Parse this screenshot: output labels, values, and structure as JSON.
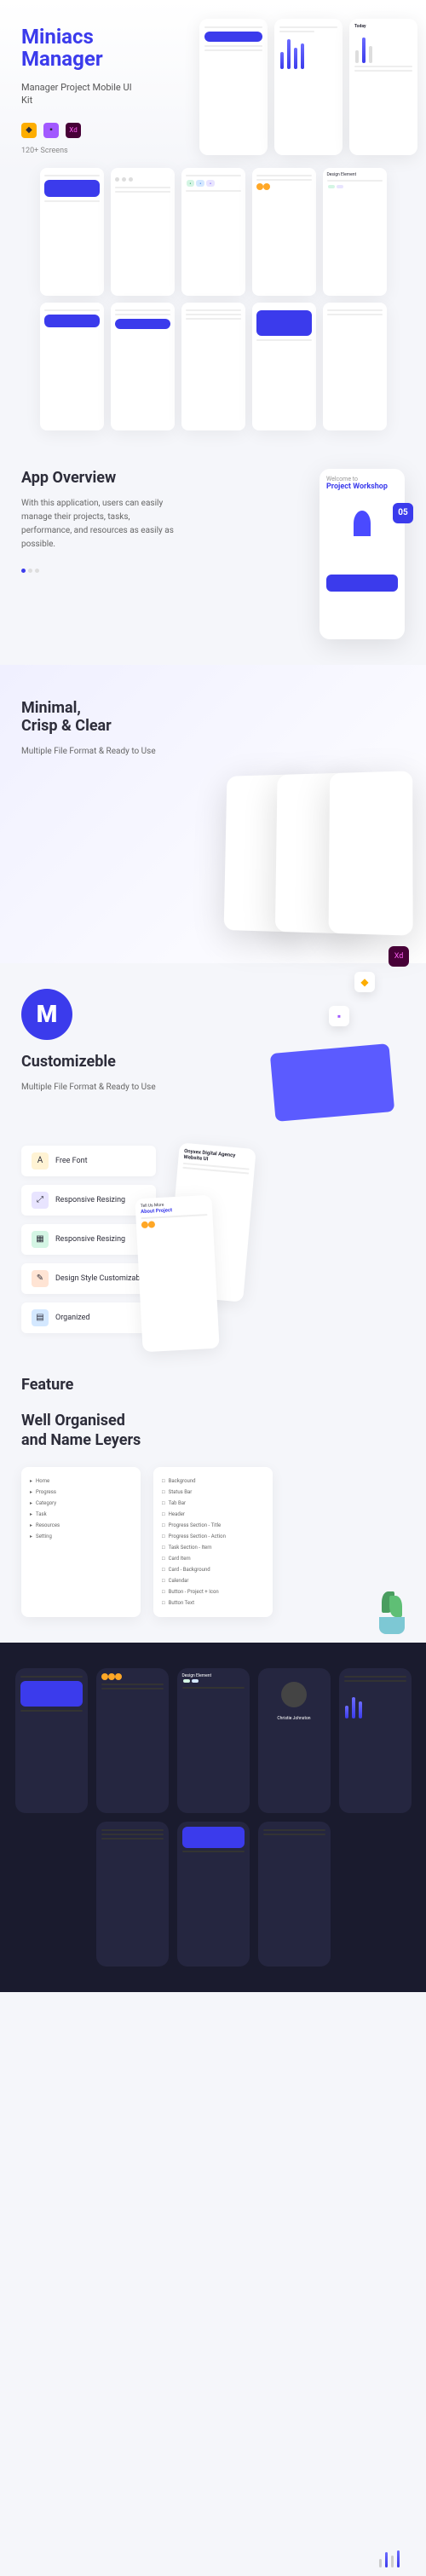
{
  "hero": {
    "title_line1": "Miniacs",
    "title_line2": "Manager",
    "subtitle": "Manager Project Mobile UI Kit",
    "screens_count": "120+ Screens"
  },
  "overview": {
    "title": "App Overview",
    "description": "With this application, users can easily manage their projects, tasks, performance, and resources as easily as possible.",
    "welcome": "Welcome to",
    "workshop": "Project Workshop",
    "date_badge": "05"
  },
  "minimal": {
    "title_line1": "Minimal,",
    "title_line2": "Crisp & Clear",
    "description": "Multiple File Format & Ready to Use"
  },
  "customizable": {
    "title": "Customizeble",
    "description": "Multiple File Format & Ready to Use"
  },
  "features": {
    "items": [
      {
        "label": "Free Font",
        "icon_class": "fi-yellow"
      },
      {
        "label": "Responsive Resizing",
        "icon_class": "fi-purple"
      },
      {
        "label": "Responsive Resizing",
        "icon_class": "fi-green"
      },
      {
        "label": "Design Style Customizable",
        "icon_class": "fi-orange"
      },
      {
        "label": "Organized",
        "icon_class": "fi-blue"
      }
    ],
    "section_title": "Feature",
    "about_title": "Tell Us More",
    "about_subtitle": "About Project",
    "page_title": "Onyxex Digital Agency Website UI"
  },
  "layers": {
    "title_line1": "Well Organised",
    "title_line2": "and Name Leyers",
    "panel1_items": [
      "Home",
      "Progress",
      "Category",
      "Task",
      "Resources",
      "Setting"
    ],
    "panel2_items": [
      "Background",
      "Status Bar",
      "Tab Bar",
      "Header",
      "Progress Section - Title",
      "Progress Section - Action",
      "Task Section - Item",
      "Card Item",
      "Card - Background",
      "Calendar",
      "Button - Project + Icon",
      "Button Text"
    ]
  },
  "dark": {
    "design_element": "Design Element",
    "profile_name": "Christie Johnston"
  }
}
